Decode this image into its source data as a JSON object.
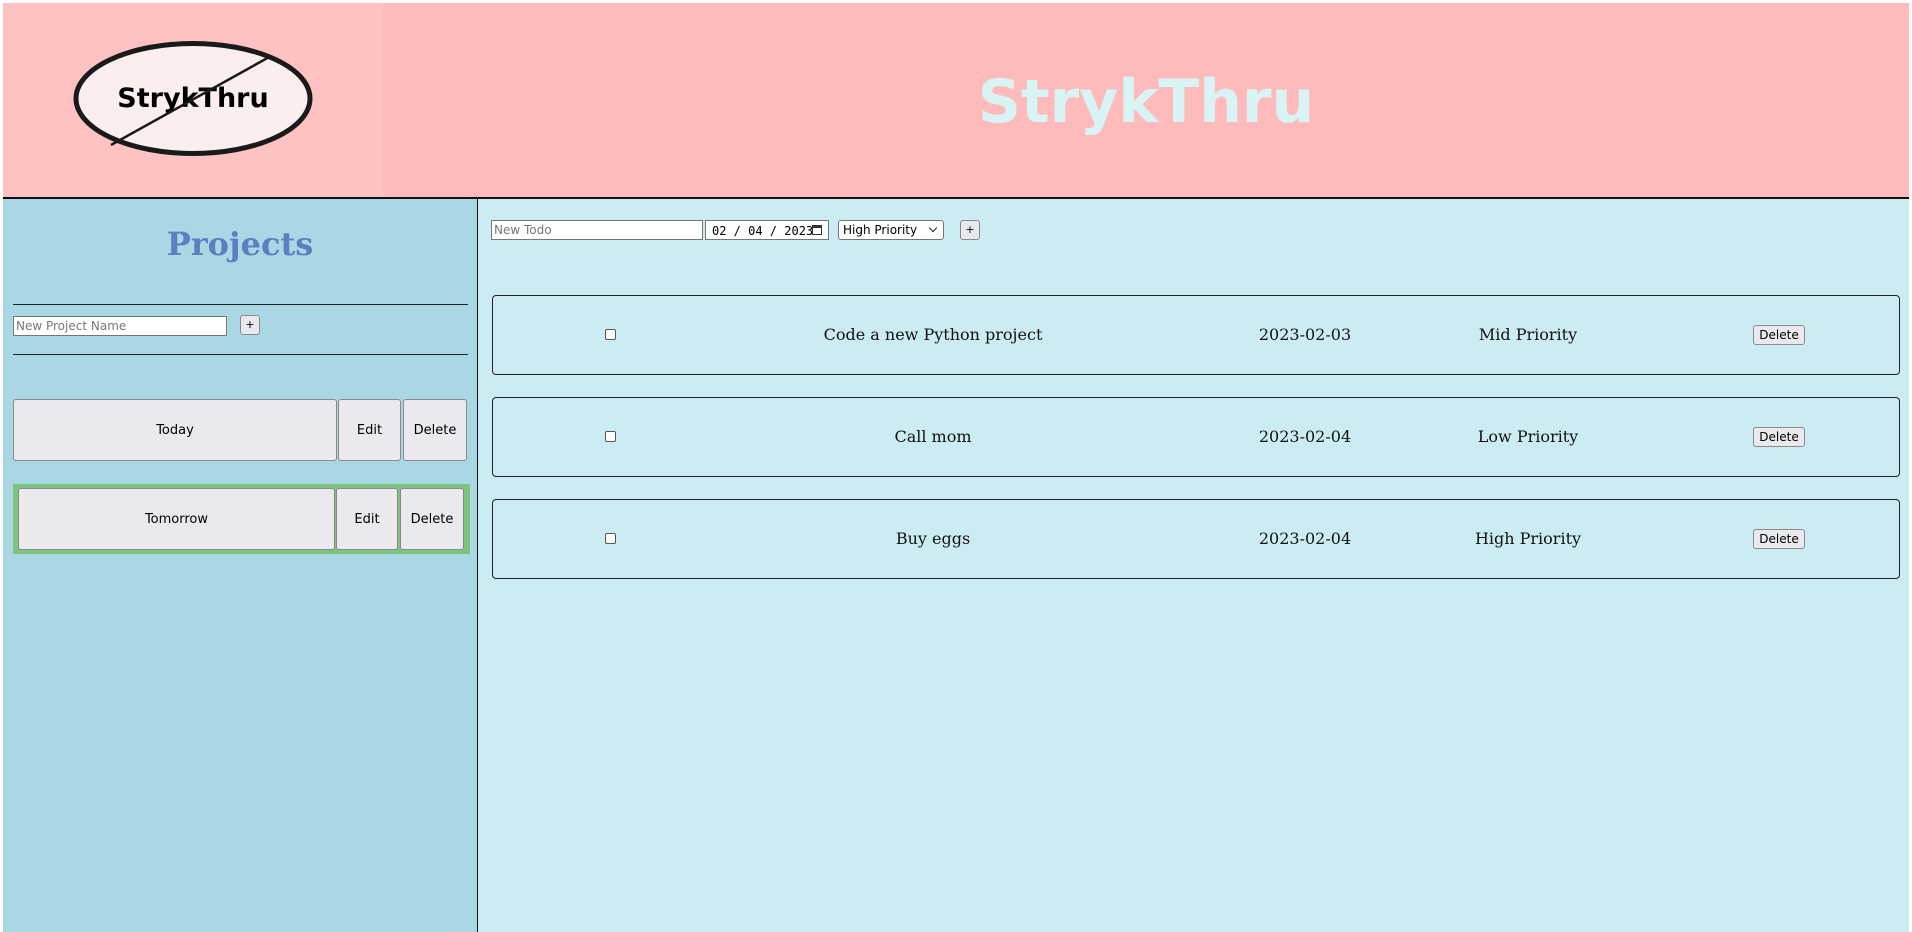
{
  "header": {
    "logo_text": "StrykThru",
    "title": "StrykThru"
  },
  "sidebar": {
    "title": "Projects",
    "new_project": {
      "placeholder": "New Project Name",
      "add_label": "+"
    },
    "projects": [
      {
        "name": "Today",
        "edit_label": "Edit",
        "delete_label": "Delete",
        "selected": false
      },
      {
        "name": "Tomorrow",
        "edit_label": "Edit",
        "delete_label": "Delete",
        "selected": true
      }
    ]
  },
  "main": {
    "new_todo": {
      "placeholder": "New Todo",
      "date_value": "02 / 04 / 2023",
      "priority_value": "High Priority",
      "add_label": "+"
    },
    "todos": [
      {
        "title": "Code a new Python project",
        "date": "2023-02-03",
        "priority": "Mid Priority",
        "delete_label": "Delete",
        "done": false
      },
      {
        "title": "Call mom",
        "date": "2023-02-04",
        "priority": "Low Priority",
        "delete_label": "Delete",
        "done": false
      },
      {
        "title": "Buy eggs",
        "date": "2023-02-04",
        "priority": "High Priority",
        "delete_label": "Delete",
        "done": false
      }
    ]
  },
  "colors": {
    "header_bg": "#ffbbbb",
    "title_color": "#d9f4f4",
    "sidebar_bg": "#a9d7e3",
    "main_bg": "#ccecf4",
    "projects_title": "#5b7fc0",
    "selected_project": "#7cc47e"
  },
  "icons": {
    "date_picker": "calendar-icon",
    "select_arrow": "chevron-down-icon"
  }
}
